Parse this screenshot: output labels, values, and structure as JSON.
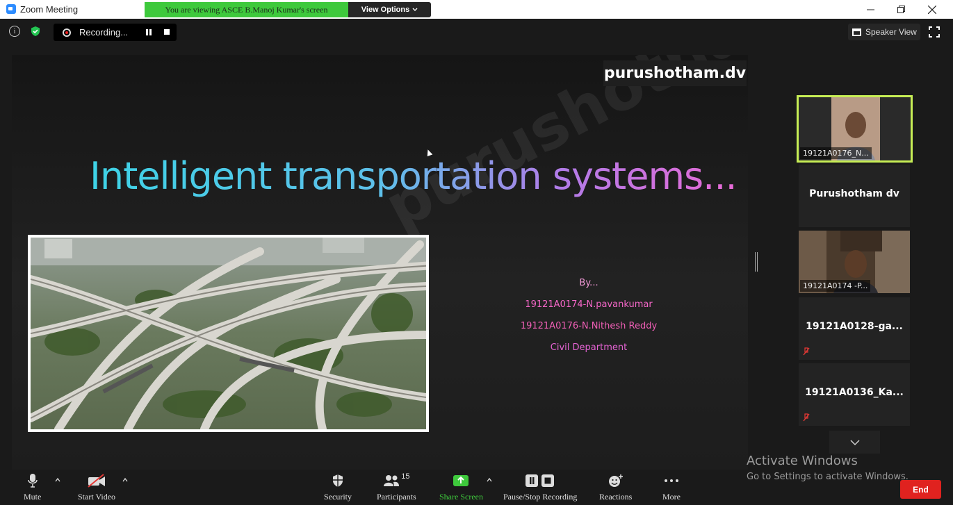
{
  "window": {
    "title": "Zoom Meeting",
    "viewing_banner": "You are viewing ASCE B.Manoj Kumar's screen",
    "view_options": "View Options",
    "controls": [
      "minimize-icon",
      "restore-icon",
      "close-icon"
    ]
  },
  "top_bar": {
    "recording_label": "Recording...",
    "speaker_view_label": "Speaker View"
  },
  "slide": {
    "watermark_badge": "purushotham.dv",
    "diagonal_watermark": "purushotham.dv",
    "title": "Intelligent transportation systems...",
    "image_alt": "highway interchange aerial photo",
    "credits": [
      "By...",
      "19121A0174-N.pavankumar",
      "19121A0176-N.Nithesh Reddy",
      "Civil Department"
    ]
  },
  "participants": [
    {
      "name": "19121A0176_N...",
      "type": "video",
      "active": true
    },
    {
      "name": "Purushotham dv",
      "type": "name-only",
      "muted": false
    },
    {
      "name": "19121A0174 -P...",
      "type": "video",
      "active": false
    },
    {
      "name": "19121A0128-ga...",
      "type": "name-only",
      "muted": true
    },
    {
      "name": "19121A0136_Ka...",
      "type": "name-only",
      "muted": true
    }
  ],
  "activate_windows": {
    "line1": "Activate Windows",
    "line2": "Go to Settings to activate Windows."
  },
  "toolbar": {
    "mute": "Mute",
    "start_video": "Start Video",
    "security": "Security",
    "participants": "Participants",
    "participants_count": "15",
    "share_screen": "Share Screen",
    "pause_stop_recording": "Pause/Stop Recording",
    "reactions": "Reactions",
    "more": "More",
    "end": "End"
  },
  "colors": {
    "share_green": "#3ec93c",
    "active_speaker_border": "#c7ee55",
    "end_red": "#e0221f"
  }
}
